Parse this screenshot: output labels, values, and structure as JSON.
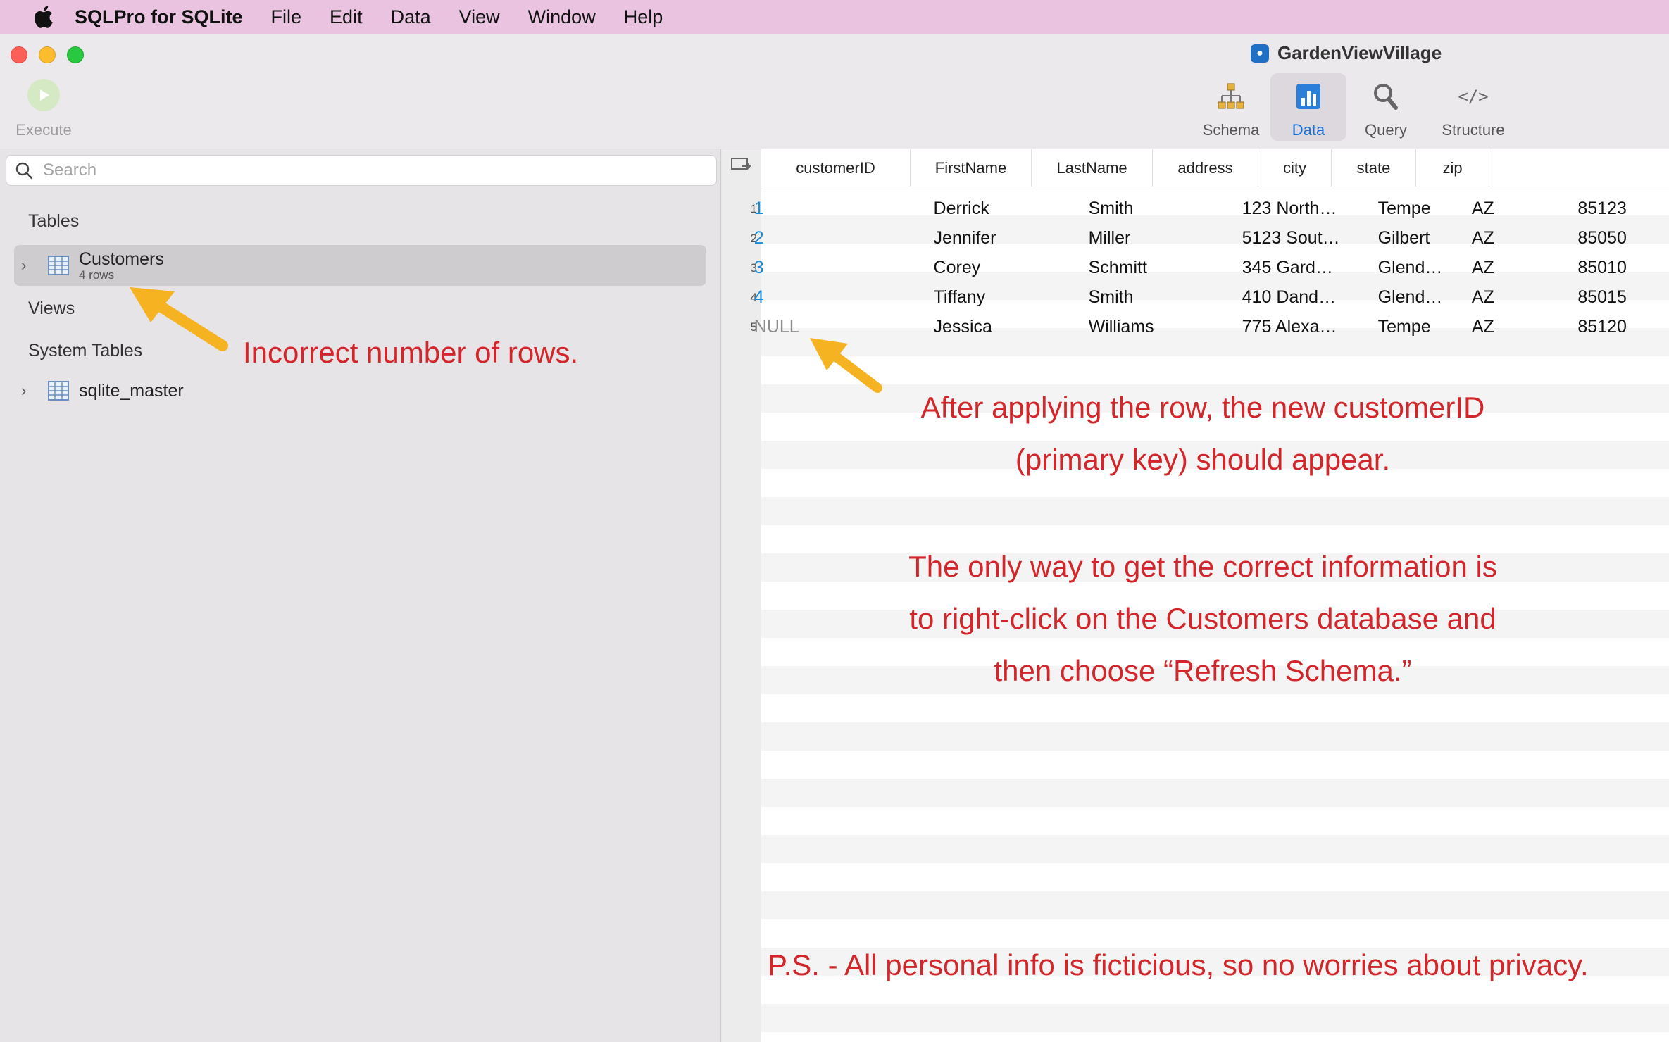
{
  "menubar": {
    "app_name": "SQLPro for SQLite",
    "items": [
      "File",
      "Edit",
      "Data",
      "View",
      "Window",
      "Help"
    ]
  },
  "window": {
    "title": "GardenViewVillage"
  },
  "toolbar": {
    "execute_label": "Execute",
    "tabs": [
      {
        "label": "Schema"
      },
      {
        "label": "Data",
        "active": true
      },
      {
        "label": "Query"
      },
      {
        "label": "Structure"
      }
    ]
  },
  "sidebar": {
    "search_placeholder": "Search",
    "tables_label": "Tables",
    "tables": [
      {
        "name": "Customers",
        "sub": "4 rows"
      }
    ],
    "views_label": "Views",
    "system_tables_label": "System Tables",
    "system_tables": [
      {
        "name": "sqlite_master"
      }
    ]
  },
  "grid": {
    "columns": [
      "customerID",
      "FirstName",
      "LastName",
      "address",
      "city",
      "state",
      "zip"
    ],
    "rows": [
      {
        "num": "1",
        "customerID": "1",
        "FirstName": "Derrick",
        "LastName": "Smith",
        "address": "123 North…",
        "city": "Tempe",
        "state": "AZ",
        "zip": "85123"
      },
      {
        "num": "2",
        "customerID": "2",
        "FirstName": "Jennifer",
        "LastName": "Miller",
        "address": "5123 Sout…",
        "city": "Gilbert",
        "state": "AZ",
        "zip": "85050"
      },
      {
        "num": "3",
        "customerID": "3",
        "FirstName": "Corey",
        "LastName": "Schmitt",
        "address": "345 Gard…",
        "city": "Glend…",
        "state": "AZ",
        "zip": "85010"
      },
      {
        "num": "4",
        "customerID": "4",
        "FirstName": "Tiffany",
        "LastName": "Smith",
        "address": "410 Dand…",
        "city": "Glend…",
        "state": "AZ",
        "zip": "85015"
      },
      {
        "num": "5",
        "customerID": "NULL",
        "FirstName": "Jessica",
        "LastName": "Williams",
        "address": "775 Alexa…",
        "city": "Tempe",
        "state": "AZ",
        "zip": "85120"
      }
    ]
  },
  "annotations": {
    "rows_note": "Incorrect number of rows.",
    "id_note_1": "After applying the row, the new customerID",
    "id_note_2": "(primary key) should appear.",
    "refresh_note_1": "The only way to get the correct information is",
    "refresh_note_2": "to right-click on the Customers database and",
    "refresh_note_3": "then choose “Refresh Schema.”",
    "ps_note": "P.S. - All personal info is ficticious, so no worries about privacy."
  },
  "colors": {
    "annotation": "#d3262a",
    "arrow": "#f5b321",
    "accent": "#1a6fd6",
    "menubar": "#e9c3df"
  },
  "icons": [
    "apple-icon",
    "play-icon",
    "schema-icon",
    "data-chart-icon",
    "magnifier-icon",
    "code-icon",
    "table-icon",
    "chevron-right-icon",
    "search-icon"
  ]
}
